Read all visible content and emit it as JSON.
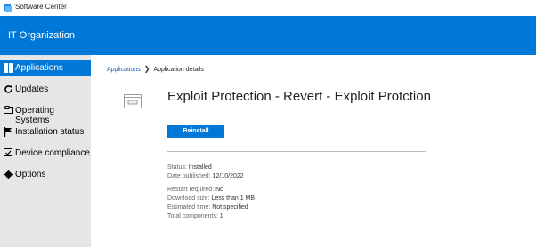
{
  "window": {
    "title": "Software Center"
  },
  "header": {
    "org_name": "IT Organization"
  },
  "sidebar": {
    "items": [
      {
        "label": "Applications",
        "icon": "grid-icon",
        "active": true
      },
      {
        "label": "Updates",
        "icon": "refresh-icon"
      },
      {
        "label": "Operating Systems",
        "icon": "monitor-icon"
      },
      {
        "label": "Installation status",
        "icon": "flag-icon"
      },
      {
        "label": "Device compliance",
        "icon": "compliance-icon"
      },
      {
        "label": "Options",
        "icon": "gear-icon"
      }
    ]
  },
  "breadcrumb": {
    "parent": "Applications",
    "current": "Application details"
  },
  "app": {
    "title": "Exploit Protection - Revert - Exploit Protction",
    "reinstall_label": "Reinstall",
    "status_label": "Status:",
    "status_value": "Installed",
    "published_label": "Date published:",
    "published_value": "12/10/2022",
    "restart_label": "Restart required:",
    "restart_value": "No",
    "download_label": "Download size:",
    "download_value": "Less than 1 MB",
    "time_label": "Estimated time:",
    "time_value": "Not specified",
    "components_label": "Total components:",
    "components_value": "1"
  },
  "colors": {
    "accent": "#0078d7",
    "sidebar_bg": "#e6e6e6"
  }
}
